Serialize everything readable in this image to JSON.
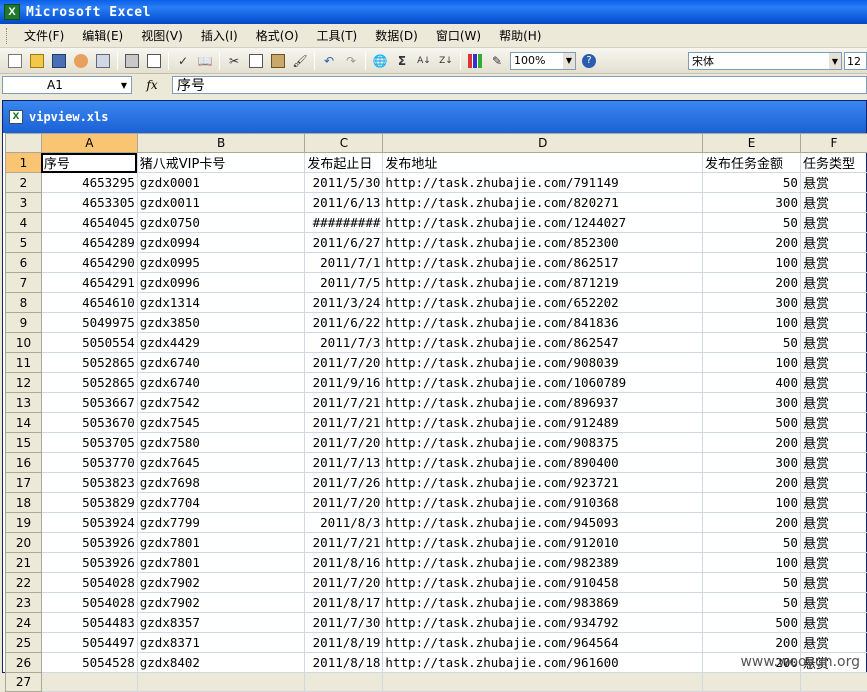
{
  "app": {
    "title": "Microsoft Excel",
    "icon": "excel-icon"
  },
  "menu": [
    "文件(F)",
    "编辑(E)",
    "视图(V)",
    "插入(I)",
    "格式(O)",
    "工具(T)",
    "数据(D)",
    "窗口(W)",
    "帮助(H)"
  ],
  "toolbar": {
    "zoom": "100%",
    "font": "宋体",
    "size": "12"
  },
  "formula_bar": {
    "cell": "A1",
    "fx": "fx",
    "content": "序号"
  },
  "workbook": {
    "filename": "vipview.xls"
  },
  "columns": [
    "A",
    "B",
    "C",
    "D",
    "E",
    "F"
  ],
  "header_row": [
    "序号",
    "猪八戒VIP卡号",
    "发布起止日",
    "发布地址",
    "发布任务金额",
    "任务类型"
  ],
  "rows": [
    [
      "4653295",
      "gzdx0001",
      "2011/5/30",
      "http://task.zhubajie.com/791149",
      "50",
      "悬赏"
    ],
    [
      "4653305",
      "gzdx0011",
      "2011/6/13",
      "http://task.zhubajie.com/820271",
      "300",
      "悬赏"
    ],
    [
      "4654045",
      "gzdx0750",
      "#########",
      "http://task.zhubajie.com/1244027",
      "50",
      "悬赏"
    ],
    [
      "4654289",
      "gzdx0994",
      "2011/6/27",
      "http://task.zhubajie.com/852300",
      "200",
      "悬赏"
    ],
    [
      "4654290",
      "gzdx0995",
      "2011/7/1",
      "http://task.zhubajie.com/862517",
      "100",
      "悬赏"
    ],
    [
      "4654291",
      "gzdx0996",
      "2011/7/5",
      "http://task.zhubajie.com/871219",
      "200",
      "悬赏"
    ],
    [
      "4654610",
      "gzdx1314",
      "2011/3/24",
      "http://task.zhubajie.com/652202",
      "300",
      "悬赏"
    ],
    [
      "5049975",
      "gzdx3850",
      "2011/6/22",
      "http://task.zhubajie.com/841836",
      "100",
      "悬赏"
    ],
    [
      "5050554",
      "gzdx4429",
      "2011/7/3",
      "http://task.zhubajie.com/862547",
      "50",
      "悬赏"
    ],
    [
      "5052865",
      "gzdx6740",
      "2011/7/20",
      "http://task.zhubajie.com/908039",
      "100",
      "悬赏"
    ],
    [
      "5052865",
      "gzdx6740",
      "2011/9/16",
      "http://task.zhubajie.com/1060789",
      "400",
      "悬赏"
    ],
    [
      "5053667",
      "gzdx7542",
      "2011/7/21",
      "http://task.zhubajie.com/896937",
      "300",
      "悬赏"
    ],
    [
      "5053670",
      "gzdx7545",
      "2011/7/21",
      "http://task.zhubajie.com/912489",
      "500",
      "悬赏"
    ],
    [
      "5053705",
      "gzdx7580",
      "2011/7/20",
      "http://task.zhubajie.com/908375",
      "200",
      "悬赏"
    ],
    [
      "5053770",
      "gzdx7645",
      "2011/7/13",
      "http://task.zhubajie.com/890400",
      "300",
      "悬赏"
    ],
    [
      "5053823",
      "gzdx7698",
      "2011/7/26",
      "http://task.zhubajie.com/923721",
      "200",
      "悬赏"
    ],
    [
      "5053829",
      "gzdx7704",
      "2011/7/20",
      "http://task.zhubajie.com/910368",
      "100",
      "悬赏"
    ],
    [
      "5053924",
      "gzdx7799",
      "2011/8/3",
      "http://task.zhubajie.com/945093",
      "200",
      "悬赏"
    ],
    [
      "5053926",
      "gzdx7801",
      "2011/7/21",
      "http://task.zhubajie.com/912010",
      "50",
      "悬赏"
    ],
    [
      "5053926",
      "gzdx7801",
      "2011/8/16",
      "http://task.zhubajie.com/982389",
      "100",
      "悬赏"
    ],
    [
      "5054028",
      "gzdx7902",
      "2011/7/20",
      "http://task.zhubajie.com/910458",
      "50",
      "悬赏"
    ],
    [
      "5054028",
      "gzdx7902",
      "2011/8/17",
      "http://task.zhubajie.com/983869",
      "50",
      "悬赏"
    ],
    [
      "5054483",
      "gzdx8357",
      "2011/7/30",
      "http://task.zhubajie.com/934792",
      "500",
      "悬赏"
    ],
    [
      "5054497",
      "gzdx8371",
      "2011/8/19",
      "http://task.zhubajie.com/964564",
      "200",
      "悬赏"
    ],
    [
      "5054528",
      "gzdx8402",
      "2011/8/18",
      "http://task.zhubajie.com/961600",
      "200",
      "悬赏"
    ]
  ],
  "row_numbers": [
    "1",
    "2",
    "3",
    "4",
    "5",
    "6",
    "7",
    "8",
    "9",
    "10",
    "11",
    "12",
    "13",
    "14",
    "15",
    "16",
    "17",
    "18",
    "19",
    "20",
    "21",
    "22",
    "23",
    "24",
    "25",
    "26",
    "27"
  ],
  "watermark": "www.wooyun.org"
}
